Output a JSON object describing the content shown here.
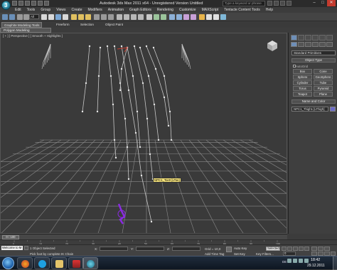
{
  "window": {
    "title": "Autodesk 3ds Max 2011 x64 - Unregistered Version   Untitled",
    "help_search_placeholder": "Type a keyword or phrase",
    "min": "–",
    "max": "□",
    "close": "✕"
  },
  "menubar": [
    "Edit",
    "Tools",
    "Group",
    "Views",
    "Create",
    "Modifiers",
    "Animation",
    "Graph Editors",
    "Rendering",
    "Customize",
    "MAXScript",
    "Tentacle Content Tools",
    "Help"
  ],
  "toolbar": {
    "selection_filter": "All"
  },
  "ribbon": {
    "tabs": [
      "Graphite Modeling Tools",
      "Freeform",
      "Selection",
      "Object Paint"
    ],
    "panel": "Polygon Modeling"
  },
  "viewport": {
    "label": "[ + ] [ Perspective ] [ Smooth + Highlights ]",
    "tooltip": "NPC1_Toe0 [LToe]"
  },
  "command_panel": {
    "primitive_type": "Standard Primitives",
    "object_type_title": "Object Type",
    "autogrid_label": "AutoGrid",
    "buttons": [
      "Box",
      "Cone",
      "Sphere",
      "GeoSphere",
      "Cylinder",
      "Tube",
      "Torus",
      "Pyramid",
      "Teapot",
      "Plane"
    ],
    "name_color_title": "Name and Color",
    "name_value": "NPC1_Thigh1 [LThigh]"
  },
  "timeslider": {
    "frame_counter": "0 / 100"
  },
  "trackbar": {
    "tick_labels": [
      "0",
      "10",
      "20",
      "30",
      "40",
      "50",
      "60",
      "70",
      "80",
      "90",
      "100"
    ]
  },
  "status": {
    "maxscript": "Welcome to M",
    "objects_selected": "1 Object Selected",
    "prompt": "Pick foot by complete IK Chain",
    "x_label": "X:",
    "y_label": "Y:",
    "z_label": "Z:",
    "grid": "Grid = 10,0",
    "add_time_tag": "Add Time Tag",
    "auto_key": "Auto Key",
    "set_key": "Set Key",
    "selected": "Selected",
    "key_filters": "Key Filters...",
    "frame": "0"
  },
  "taskbar": {
    "lang": "DE",
    "time": "18:42",
    "date": "29.12.2011"
  },
  "colors": {
    "skeleton": "#c8c8c8",
    "selected_bone": "#8a2be2",
    "accent_red": "#c43b2e",
    "tooltip_bg": "#f5e27a"
  }
}
